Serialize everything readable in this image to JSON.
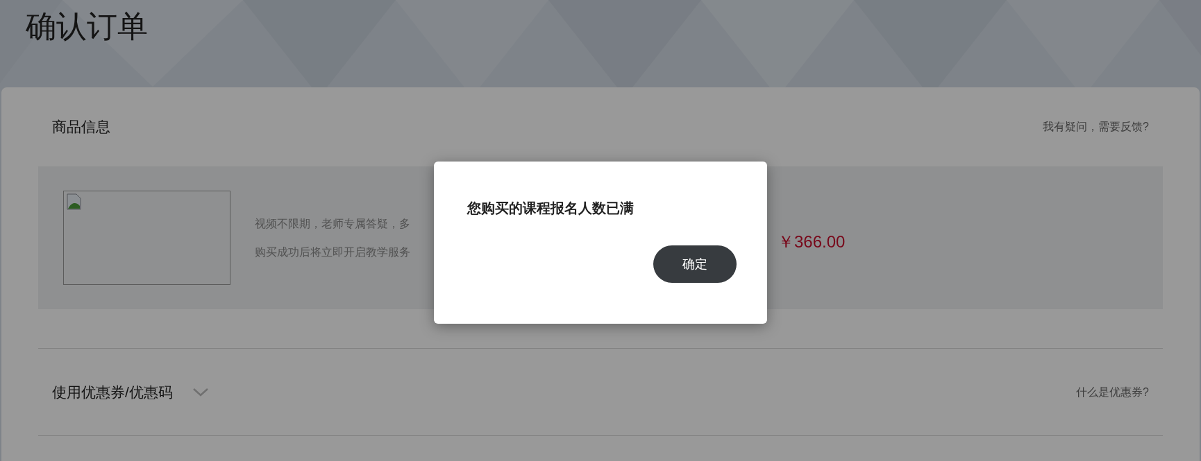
{
  "page": {
    "title": "确认订单"
  },
  "product_section": {
    "heading": "商品信息",
    "feedback_link": "我有疑问，需要反馈?",
    "description_lines": [
      "视频不限期，老师专属答疑，多",
      "购买成功后将立即开启教学服务"
    ],
    "price": "￥366.00"
  },
  "coupon_section": {
    "heading": "使用优惠券/优惠码",
    "expanded": false,
    "help_link": "什么是优惠券?"
  },
  "dialog": {
    "message": "您购买的课程报名人数已满",
    "buttons": [
      "确定"
    ]
  }
}
